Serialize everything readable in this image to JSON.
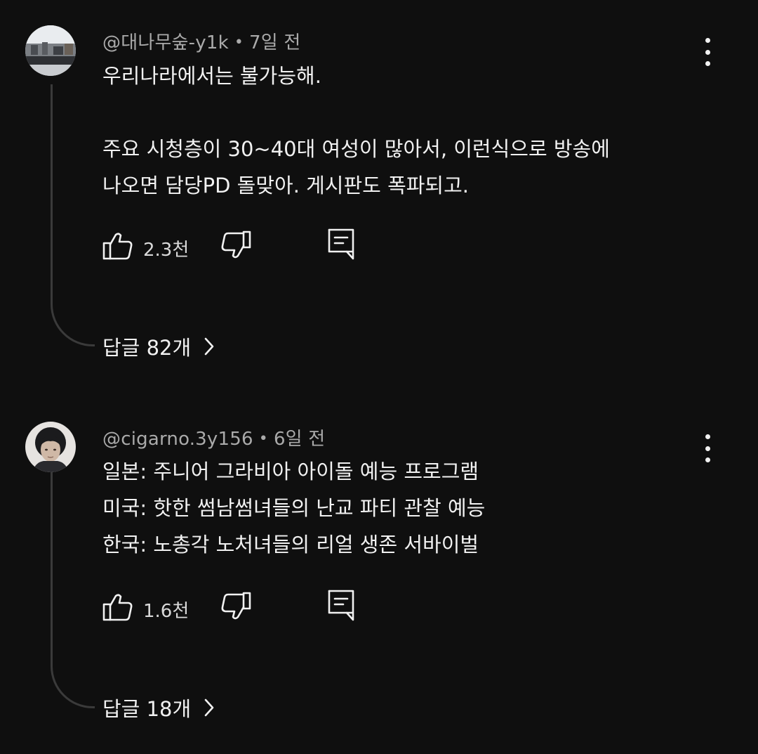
{
  "comments": [
    {
      "author": "@대나무숲-y1k",
      "separator": "•",
      "time": "7일 전",
      "text": "우리나라에서는 불가능해.\n\n주요 시청층이 30~40대 여성이 많아서, 이런식으로 방송에\n나오면 담당PD 돌맞아. 게시판도 폭파되고.",
      "like_count": "2.3천",
      "replies_label": "답글 82개",
      "avatar_icon": "landscape-photo-avatar"
    },
    {
      "author": "@cigarno.3y156",
      "separator": "•",
      "time": "6일 전",
      "text": "일본: 주니어 그라비아 아이돌 예능 프로그램\n미국: 핫한 썸남썸녀들의 난교 파티 관찰 예능\n한국: 노총각 노처녀들의 리얼 생존 서바이벌",
      "like_count": "1.6천",
      "replies_label": "답글 18개",
      "avatar_icon": "person-portrait-avatar"
    }
  ],
  "icons": {
    "like": "thumbs-up-icon",
    "dislike": "thumbs-down-icon",
    "reply": "reply-comment-icon",
    "menu": "more-vertical-icon",
    "chevron": "chevron-right-icon"
  },
  "colors": {
    "background": "#0f0f0f",
    "text": "#f1f1f1",
    "meta": "#aaaaaa",
    "thread_line": "#3a3a3a"
  }
}
